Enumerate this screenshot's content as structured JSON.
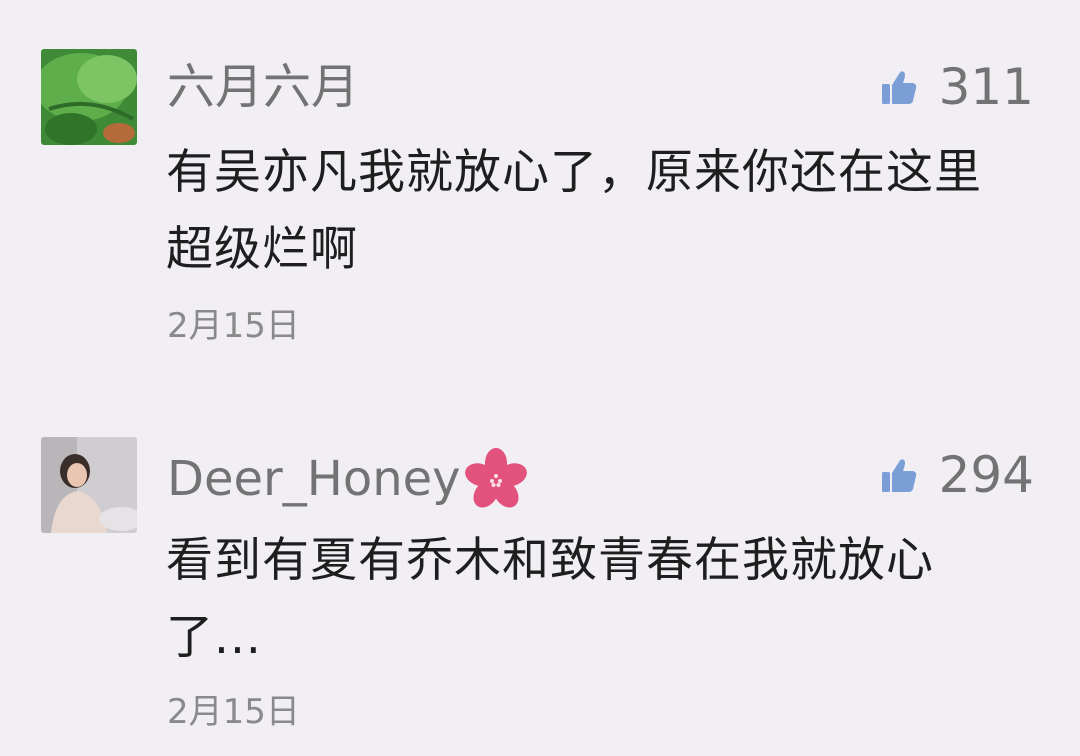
{
  "comments": [
    {
      "username": "六月六月",
      "avatar": "green-leaf-photo",
      "likes": "311",
      "text": "有吴亦凡我就放心了，原来你还在这里超级烂啊",
      "date": "2月15日"
    },
    {
      "username": "Deer_Honey",
      "username_decoration": "pink-flower-icon",
      "avatar": "woman-portrait-photo",
      "likes": "294",
      "text": "看到有夏有乔木和致青春在我就放心了...",
      "date": "2月15日"
    }
  ],
  "colors": {
    "background": "#f2eff4",
    "thumb": "#7b9ed6",
    "username": "#737373",
    "text": "#1e1e1e",
    "date": "#8a8a8a",
    "flower": "#e2527c"
  }
}
